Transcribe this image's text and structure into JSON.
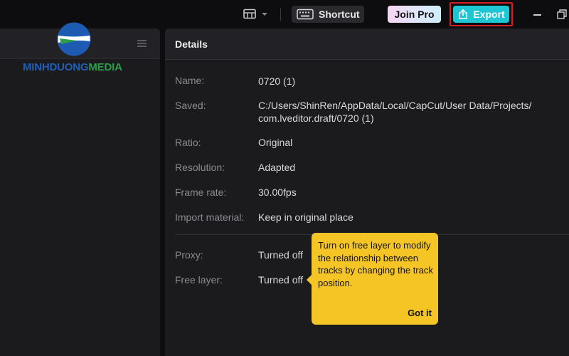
{
  "topbar": {
    "layout_icon": "layout-icon",
    "shortcut_label": "Shortcut",
    "join_pro_label": "Join Pro",
    "export_label": "Export",
    "accent_color": "#1ec6d4",
    "highlight_color": "#d41f26"
  },
  "left_panel": {
    "menu_icon": "menu-icon",
    "watermark": {
      "part1": "MINHDUONG",
      "part2": "MEDIA"
    }
  },
  "details": {
    "title": "Details",
    "rows": [
      {
        "label": "Name:",
        "value": "0720 (1)"
      },
      {
        "label": "Saved:",
        "value_line1": "C:/Users/ShinRen/AppData/Local/CapCut/User Data/Projects/",
        "value_line2": "com.lveditor.draft/0720 (1)"
      },
      {
        "label": "Ratio:",
        "value": "Original"
      },
      {
        "label": "Resolution:",
        "value": "Adapted"
      },
      {
        "label": "Frame rate:",
        "value": "30.00fps"
      },
      {
        "label": "Import material:",
        "value": "Keep in original place"
      },
      {
        "label": "Proxy:",
        "value": "Turned off"
      },
      {
        "label": "Free layer:",
        "value": "Turned off"
      }
    ]
  },
  "tooltip": {
    "text": "Turn on free layer to modify the relationship between tracks by changing the track position.",
    "button_label": "Got it",
    "background_color": "#f4c524"
  }
}
